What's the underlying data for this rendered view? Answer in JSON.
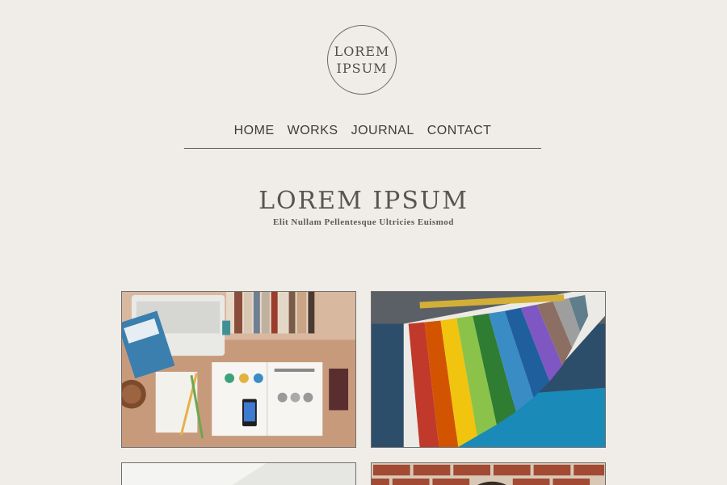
{
  "logo": {
    "line1": "LOREM",
    "line2": "IPSUM"
  },
  "nav": {
    "items": [
      "HOME",
      "WORKS",
      "JOURNAL",
      "CONTACT"
    ]
  },
  "hero": {
    "title": "LOREM IPSUM",
    "subtitle": "Elit Nullam Pellentesque Ultricies Euismod"
  },
  "gallery": {
    "tiles": [
      {
        "subject": "desk workspace photo"
      },
      {
        "subject": "color swatch fan photo"
      },
      {
        "subject": "white paper photo"
      },
      {
        "subject": "brick wall photo"
      }
    ]
  },
  "colors": {
    "background": "#f0ede8",
    "text": "#4a4a48",
    "rule": "#5a5a58"
  }
}
